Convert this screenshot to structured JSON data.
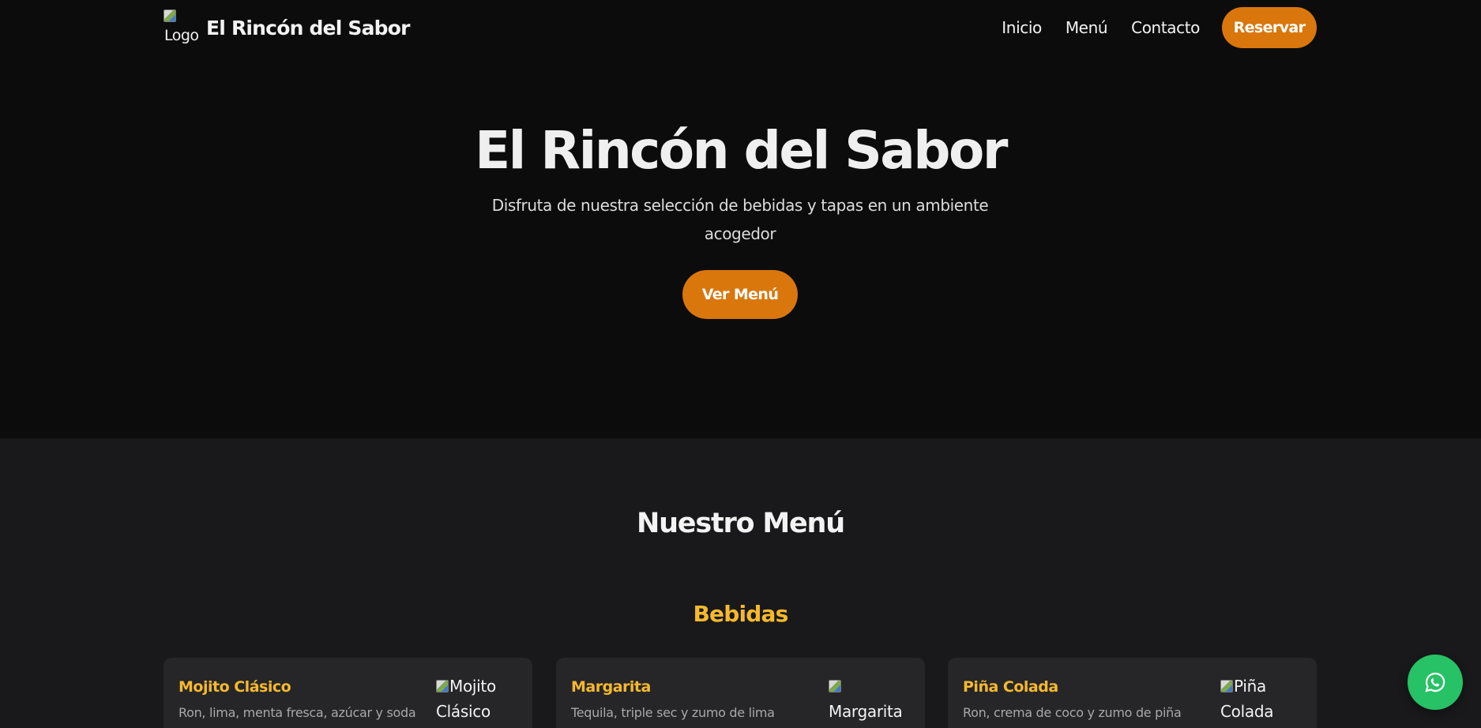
{
  "header": {
    "logo_alt": "Logo",
    "brand_name": "El Rincón del Sabor",
    "nav": [
      {
        "label": "Inicio"
      },
      {
        "label": "Menú"
      },
      {
        "label": "Contacto"
      }
    ],
    "reserve_label": "Reservar"
  },
  "hero": {
    "title": "El Rincón del Sabor",
    "subtitle": "Disfruta de nuestra selección de bebidas y tapas en un ambiente acogedor",
    "cta_label": "Ver Menú"
  },
  "menu": {
    "title": "Nuestro Menú",
    "category": "Bebidas",
    "items": [
      {
        "name": "Mojito Clásico",
        "description": "Ron, lima, menta fresca, azúcar y soda",
        "image_alt_1": "Mojito",
        "image_alt_2": "Clásico"
      },
      {
        "name": "Margarita",
        "description": "Tequila, triple sec y zumo de lima",
        "image_alt_1": "",
        "image_alt_2": "Margarita"
      },
      {
        "name": "Piña Colada",
        "description": "Ron, crema de coco y zumo de piña",
        "image_alt_1": "Piña",
        "image_alt_2": "Colada"
      }
    ]
  },
  "floating": {
    "icon": "whatsapp-icon"
  },
  "colors": {
    "accent": "#d9770c",
    "highlight": "#f6b92b",
    "background": "#0c0c0d",
    "section_bg": "#19191b",
    "card_bg": "#262628",
    "whatsapp": "#26c265"
  }
}
